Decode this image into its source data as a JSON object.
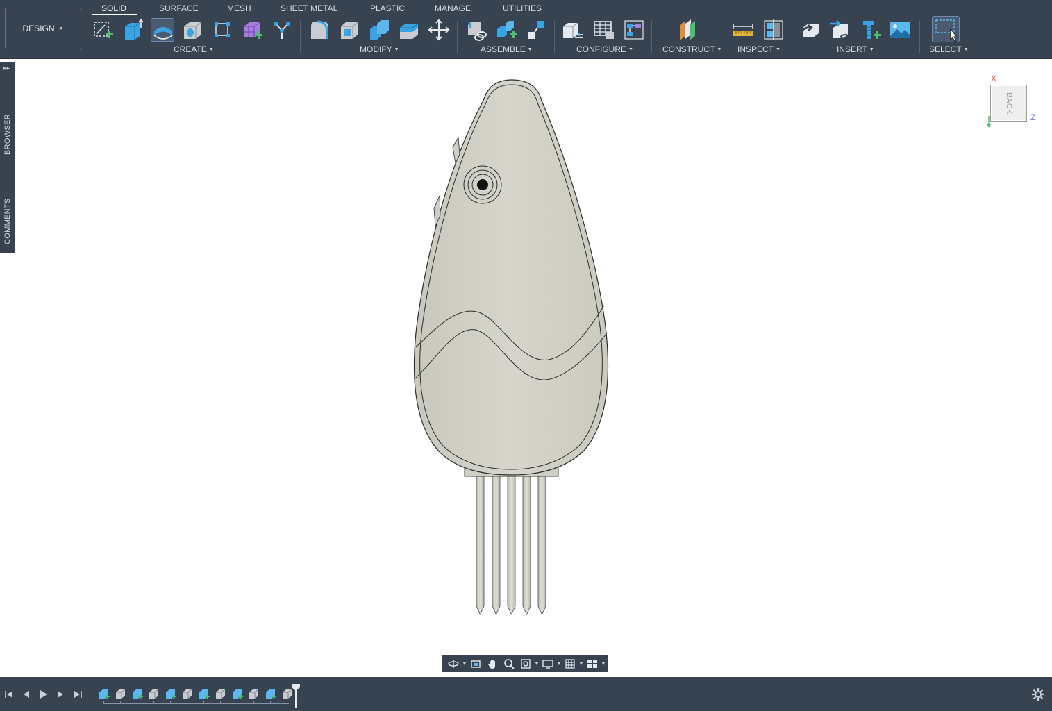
{
  "workspace": {
    "label": "DESIGN"
  },
  "tabs": [
    {
      "label": "SOLID",
      "active": true
    },
    {
      "label": "SURFACE"
    },
    {
      "label": "MESH"
    },
    {
      "label": "SHEET METAL"
    },
    {
      "label": "PLASTIC"
    },
    {
      "label": "MANAGE"
    },
    {
      "label": "UTILITIES"
    }
  ],
  "groups": {
    "create": "CREATE",
    "modify": "MODIFY",
    "assemble": "ASSEMBLE",
    "configure": "CONFIGURE",
    "construct": "CONSTRUCT",
    "inspect": "INSPECT",
    "insert": "INSERT",
    "select": "SELECT"
  },
  "tools": {
    "create": [
      "create-sketch-icon",
      "extrude-icon",
      "revolve-icon",
      "hole-icon",
      "rectangular-pattern-icon",
      "create-form-icon",
      "derive-icon"
    ],
    "modify": [
      "fillet-icon",
      "shell-icon",
      "combine-icon",
      "offset-face-icon",
      "move-copy-icon"
    ],
    "assemble": [
      "joint-icon",
      "new-component-icon",
      "as-built-joint-icon"
    ],
    "configure": [
      "configure-model-icon",
      "configuration-table-icon",
      "configuration-rules-icon"
    ],
    "construct": [
      "offset-plane-icon"
    ],
    "inspect": [
      "measure-icon",
      "section-analysis-icon"
    ],
    "insert": [
      "insert-derive-icon",
      "insert-component-icon",
      "insert-mcmaster-icon",
      "insert-canvas-icon"
    ],
    "select": [
      "window-select-icon"
    ]
  },
  "side_panel": {
    "browser": "BROWSER",
    "comments": "COMMENTS"
  },
  "viewcube": {
    "face": "BACK",
    "axis_x": "X",
    "axis_z": "Z"
  },
  "colors": {
    "toolbar_bg": "#384352",
    "model_fill": "#d1d0c6",
    "model_edge": "#2b2b2b",
    "accent_blue": "#3aa3e3",
    "accent_green": "#4cc06a"
  },
  "timeline": {
    "features": [
      "sketch",
      "body",
      "sketch",
      "body",
      "sketch",
      "body",
      "sketch",
      "body",
      "sketch",
      "body",
      "sketch",
      "body"
    ]
  }
}
